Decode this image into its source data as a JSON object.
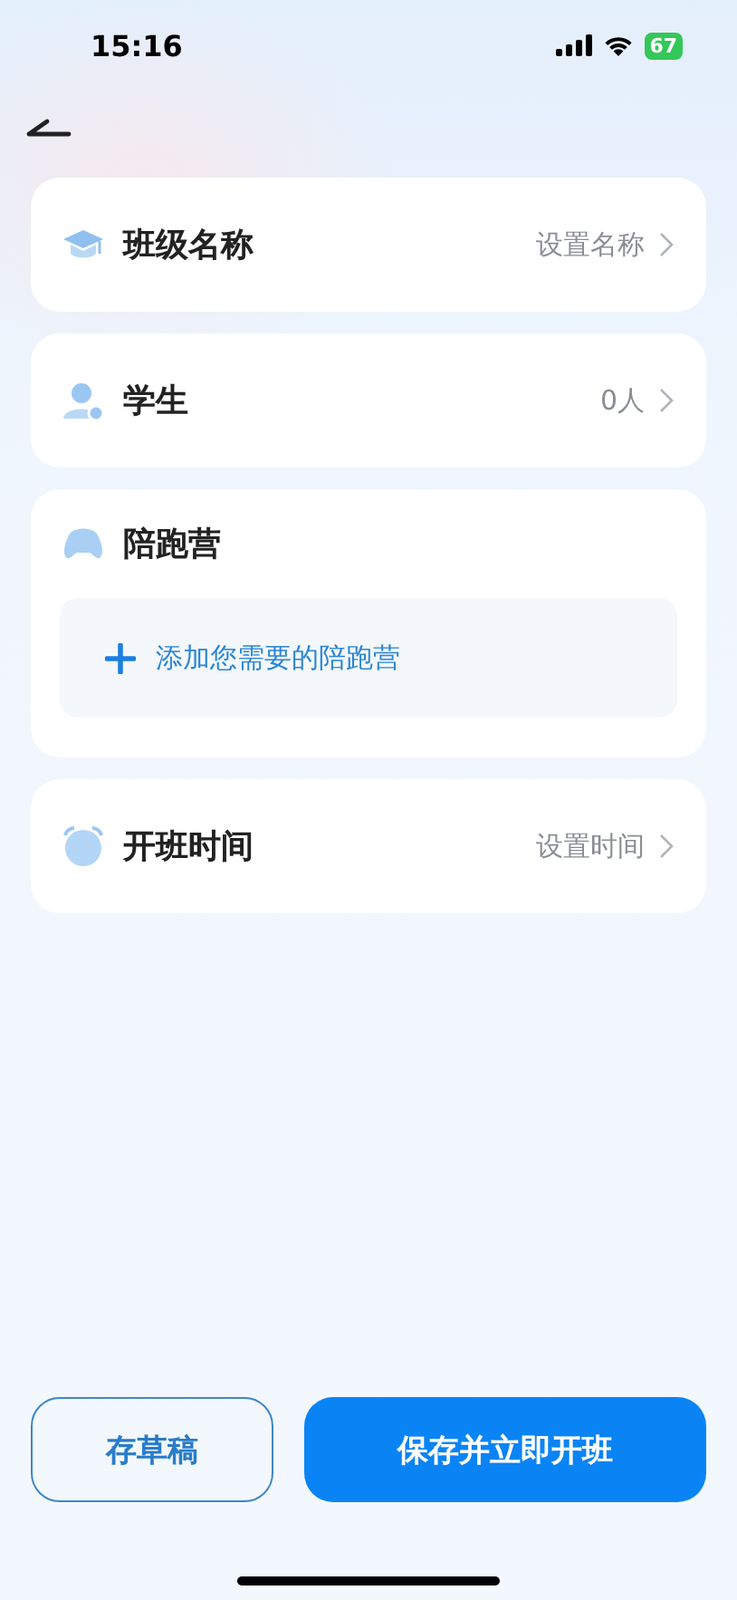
{
  "status_bar": {
    "time": "15:16",
    "battery": "67"
  },
  "items": [
    {
      "kind": "row",
      "label": "班级名称",
      "value": "设置名称"
    },
    {
      "kind": "row",
      "label": "学生",
      "value": "0人"
    },
    {
      "kind": "section",
      "label": "陪跑营",
      "add_text": "添加您需要的陪跑营"
    },
    {
      "kind": "row",
      "label": "开班时间",
      "value": "设置时间"
    }
  ],
  "buttons": {
    "draft": "存草稿",
    "submit": "保存并立即开班"
  }
}
